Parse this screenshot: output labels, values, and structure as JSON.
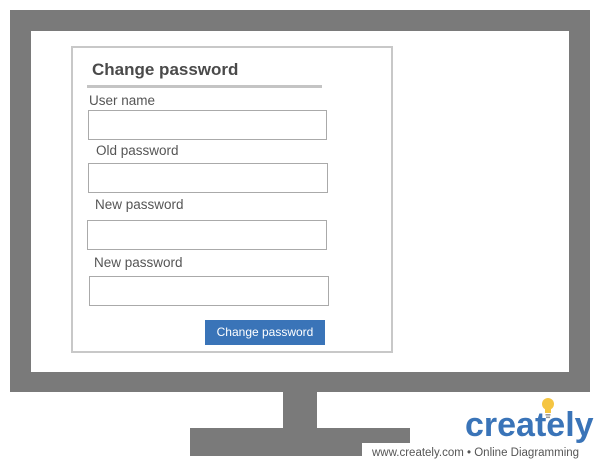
{
  "dialog": {
    "title": "Change password",
    "fields": [
      {
        "label": "User name",
        "value": ""
      },
      {
        "label": "Old password",
        "value": ""
      },
      {
        "label": "New password",
        "value": ""
      },
      {
        "label": "New password",
        "value": ""
      }
    ],
    "submit_label": "Change password",
    "accent_color": "#3a74b8"
  },
  "watermark": {
    "brand": "creately",
    "tagline": "www.creately.com • Online Diagramming",
    "brand_color": "#3a74b8",
    "icon": "lightbulb-icon"
  }
}
